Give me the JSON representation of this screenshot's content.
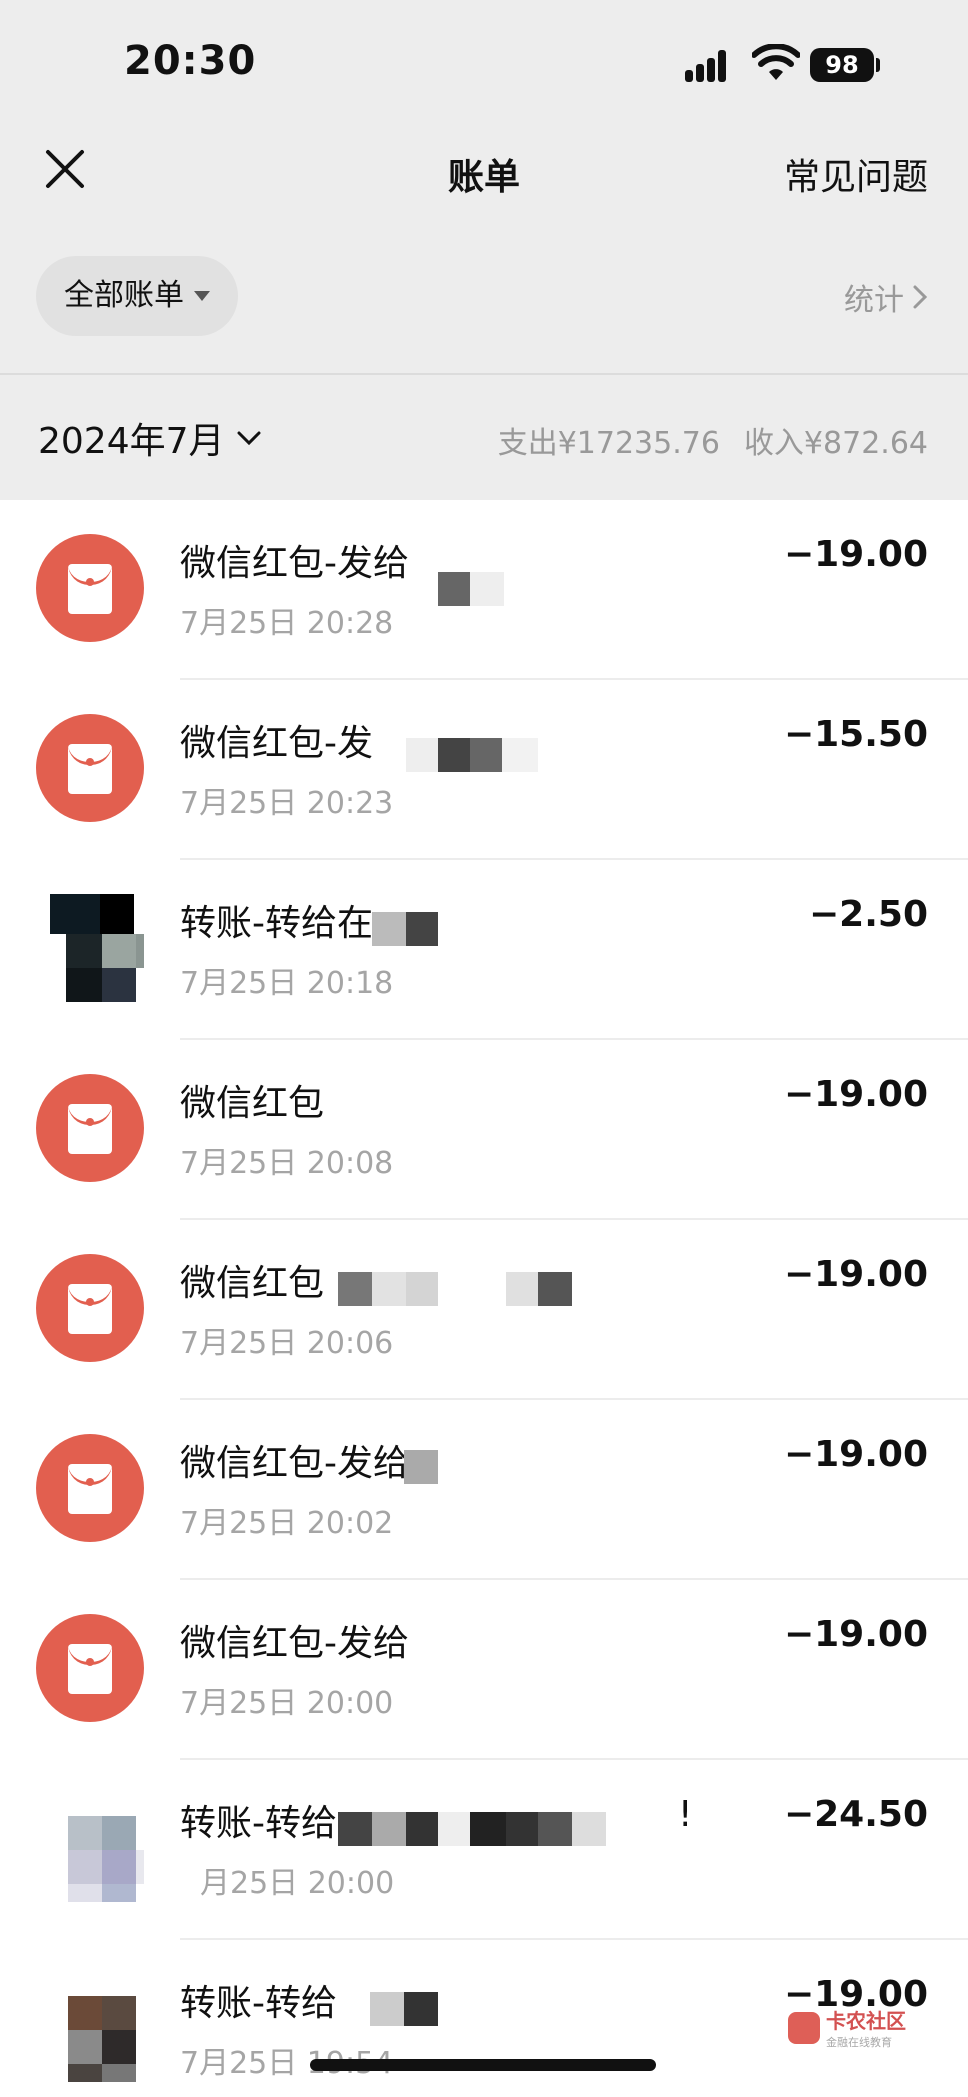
{
  "status": {
    "time": "20:30",
    "battery": "98"
  },
  "nav": {
    "title": "账单",
    "faq": "常见问题"
  },
  "filter": {
    "label": "全部账单",
    "stats": "统计"
  },
  "month": {
    "label": "2024年7月",
    "expense": "支出¥17235.76",
    "income": "收入¥872.64"
  },
  "transactions": [
    {
      "title": "微信红包-发给",
      "time": "7月25日 20:28",
      "amount": "−19.00",
      "icon": "red-packet-icon"
    },
    {
      "title": "微信红包-发",
      "time": "7月25日 20:23",
      "amount": "−15.50",
      "icon": "red-packet-icon"
    },
    {
      "title": "转账-转给在",
      "time": "7月25日 20:18",
      "amount": "−2.50",
      "icon": "avatar"
    },
    {
      "title": "微信红包",
      "time": "7月25日 20:08",
      "amount": "−19.00",
      "icon": "red-packet-icon"
    },
    {
      "title": "微信红包",
      "time": "7月25日 20:06",
      "amount": "−19.00",
      "icon": "red-packet-icon"
    },
    {
      "title": "微信红包-发给",
      "time": "7月25日 20:02",
      "amount": "−19.00",
      "icon": "red-packet-icon"
    },
    {
      "title": "微信红包-发给",
      "time": "7月25日 20:00",
      "amount": "−19.00",
      "icon": "red-packet-icon"
    },
    {
      "title": "转账-转给",
      "time": "月25日 20:00",
      "amount": "−24.50",
      "icon": "avatar",
      "suffix": "!"
    },
    {
      "title": "转账-转给",
      "time": "7月25日 19:54",
      "amount": "−19.00",
      "icon": "avatar"
    }
  ],
  "watermark": {
    "main": "卡农社区",
    "sub": "金融在线教育"
  },
  "colors": {
    "accent": "#e25f4f",
    "background": "#ededed",
    "muted": "#999999"
  }
}
